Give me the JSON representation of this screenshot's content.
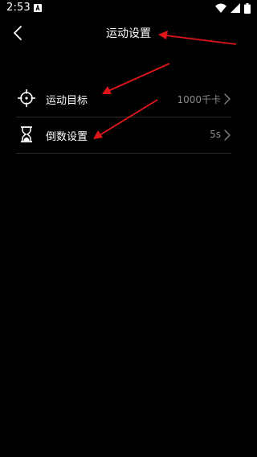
{
  "status_bar": {
    "time": "2:53",
    "icons": [
      "notification-a-icon",
      "wifi-icon",
      "signal-icon",
      "battery-icon"
    ]
  },
  "header": {
    "back_icon": "chevron-left-icon",
    "title": "运动设置"
  },
  "settings": {
    "items": [
      {
        "icon": "crosshair-target-icon",
        "label": "运动目标",
        "value": "1000千卡"
      },
      {
        "icon": "hourglass-icon",
        "label": "倒数设置",
        "value": "5s"
      }
    ]
  },
  "colors": {
    "background": "#000000",
    "text": "#ffffff",
    "secondary_text": "#8a8a8a",
    "divider": "#2e2e2e",
    "annotation_arrow": "#e0161b"
  }
}
